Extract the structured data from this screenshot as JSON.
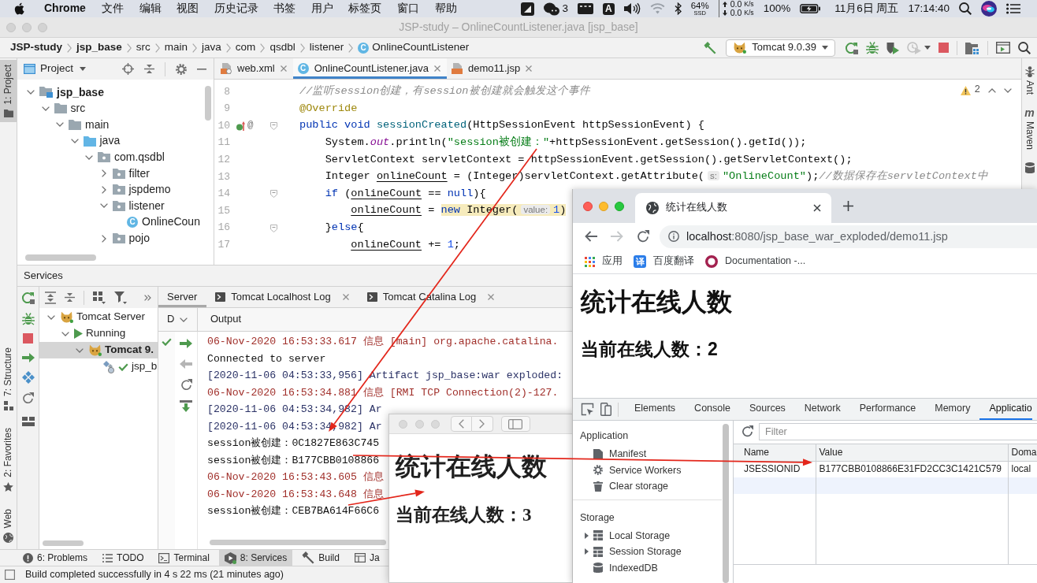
{
  "menu_bar": {
    "app": "Chrome",
    "menus": [
      "文件",
      "编辑",
      "视图",
      "历史记录",
      "书签",
      "用户",
      "标签页",
      "窗口",
      "帮助"
    ],
    "status": {
      "wechat_count": "3",
      "input_source": "A",
      "disk_usage": "64%",
      "disk_label": "SSD",
      "upload_rate": "0.0",
      "upload_unit": "K/s",
      "download_rate": "0.0",
      "download_unit": "K/s",
      "battery": "100%",
      "date": "11月6日 周五",
      "time": "17:14:40"
    }
  },
  "ide": {
    "title": "JSP-study – OnlineCountListener.java [jsp_base]",
    "breadcrumb": [
      {
        "label": "JSP-study",
        "kind": "project"
      },
      {
        "label": "jsp_base",
        "kind": "module"
      },
      {
        "label": "src",
        "kind": "folder"
      },
      {
        "label": "main",
        "kind": "folder"
      },
      {
        "label": "java",
        "kind": "folder"
      },
      {
        "label": "com",
        "kind": "folder"
      },
      {
        "label": "qsdbl",
        "kind": "folder"
      },
      {
        "label": "listener",
        "kind": "folder"
      },
      {
        "label": "OnlineCountListener",
        "kind": "class",
        "icon_letter": "C"
      }
    ],
    "run_config": "Tomcat 9.0.39",
    "left_strip": [
      {
        "label": "1: Project",
        "kind": "project",
        "selected": true
      },
      {
        "label": "7: Structure",
        "kind": "structure",
        "selected": false
      },
      {
        "label": "2: Favorites",
        "kind": "favorites",
        "selected": false
      },
      {
        "label": "Web",
        "kind": "web",
        "selected": false
      }
    ],
    "right_strip": [
      {
        "label": "Ant",
        "kind": "ant"
      },
      {
        "label": "Maven",
        "kind": "maven",
        "icon_letter": "m"
      },
      {
        "kind": "database"
      }
    ],
    "project": {
      "title": "Project",
      "tree": [
        {
          "label": "jsp_base",
          "kind": "module",
          "expanded": true,
          "children": [
            {
              "label": "src",
              "kind": "folder",
              "expanded": true,
              "children": [
                {
                  "label": "main",
                  "kind": "folder",
                  "expanded": true,
                  "children": [
                    {
                      "label": "java",
                      "kind": "source_root",
                      "expanded": true,
                      "children": [
                        {
                          "label": "com.qsdbl",
                          "kind": "package",
                          "expanded": true,
                          "children": [
                            {
                              "label": "filter",
                              "kind": "package",
                              "expanded": false
                            },
                            {
                              "label": "jspdemo",
                              "kind": "package",
                              "expanded": false
                            },
                            {
                              "label": "listener",
                              "kind": "package",
                              "expanded": true,
                              "children": [
                                {
                                  "label": "OnlineCoun",
                                  "kind": "class",
                                  "icon_letter": "C"
                                }
                              ]
                            },
                            {
                              "label": "pojo",
                              "kind": "package",
                              "expanded": false
                            }
                          ]
                        }
                      ]
                    }
                  ]
                }
              ]
            }
          ]
        }
      ]
    },
    "editor": {
      "tabs": [
        {
          "label": "web.xml",
          "kind": "xml",
          "selected": false
        },
        {
          "label": "OnlineCountListener.java",
          "kind": "class",
          "icon_letter": "C",
          "selected": true
        },
        {
          "label": "demo11.jsp",
          "kind": "jsp",
          "selected": false
        }
      ],
      "problem_count": "2",
      "lines": [
        {
          "number": "8",
          "fold": false,
          "overrides": false,
          "tokens": [
            {
              "kind": "comment",
              "text": "//监听session创建，有session被创建就会触发这个事件"
            }
          ]
        },
        {
          "number": "9",
          "fold": false,
          "overrides": false,
          "tokens": [
            {
              "kind": "annotation",
              "text": "@Override"
            }
          ]
        },
        {
          "number": "10",
          "fold": true,
          "overrides": true,
          "gutter_mark": "@",
          "tokens": [
            {
              "kind": "keyword",
              "text": "public void "
            },
            {
              "kind": "method",
              "text": "sessionCreated"
            },
            {
              "kind": "plain",
              "text": "(HttpSessionEvent httpSessionEvent) {"
            }
          ]
        },
        {
          "number": "11",
          "fold": false,
          "overrides": false,
          "tokens": [
            {
              "kind": "plain",
              "text": "    System."
            },
            {
              "kind": "static",
              "text": "out"
            },
            {
              "kind": "plain",
              "text": ".println("
            },
            {
              "kind": "string",
              "text": "\"session被创建：\""
            },
            {
              "kind": "plain",
              "text": "+httpSessionEvent.getSession().getId());"
            }
          ]
        },
        {
          "number": "12",
          "fold": false,
          "overrides": false,
          "tokens": [
            {
              "kind": "plain",
              "text": "    ServletContext servletContext = httpSessionEvent.getSession().getServletContext();"
            }
          ]
        },
        {
          "number": "13",
          "fold": false,
          "overrides": false,
          "tokens": [
            {
              "kind": "plain",
              "text": "    Integer "
            },
            {
              "kind": "variable",
              "text": "onlineCount"
            },
            {
              "kind": "plain",
              "text": " = (Integer)servletContext.getAttribute("
            },
            {
              "kind": "hint",
              "text": "s:"
            },
            {
              "kind": "string",
              "text": "\"OnlineCount\""
            },
            {
              "kind": "plain",
              "text": ");"
            },
            {
              "kind": "comment",
              "text": "//数据保存在servletContext中"
            }
          ]
        },
        {
          "number": "14",
          "fold": true,
          "overrides": false,
          "tokens": [
            {
              "kind": "keyword",
              "text": "    if"
            },
            {
              "kind": "plain",
              "text": " ("
            },
            {
              "kind": "variable",
              "text": "onlineCount"
            },
            {
              "kind": "plain",
              "text": " == "
            },
            {
              "kind": "keyword",
              "text": "null"
            },
            {
              "kind": "plain",
              "text": "){"
            }
          ]
        },
        {
          "number": "15",
          "fold": false,
          "overrides": false,
          "tokens": [
            {
              "kind": "variable",
              "text": "        onlineCount"
            },
            {
              "kind": "plain",
              "text": " = "
            },
            {
              "kind": "warning",
              "tokens": [
                {
                  "kind": "keyword",
                  "text": "new"
                },
                {
                  "kind": "plain",
                  "text": " Integer("
                },
                {
                  "kind": "hint",
                  "text": "value:"
                },
                {
                  "kind": "number",
                  "text": "1"
                },
                {
                  "kind": "plain",
                  "text": ")"
                }
              ]
            }
          ]
        },
        {
          "number": "16",
          "fold": true,
          "overrides": false,
          "tokens": [
            {
              "kind": "plain",
              "text": "    }"
            },
            {
              "kind": "keyword",
              "text": "else"
            },
            {
              "kind": "plain",
              "text": "{"
            }
          ]
        },
        {
          "number": "17",
          "fold": false,
          "overrides": false,
          "tokens": [
            {
              "kind": "variable",
              "text": "        onlineCount"
            },
            {
              "kind": "plain",
              "text": " += "
            },
            {
              "kind": "number",
              "text": "1"
            },
            {
              "kind": "plain",
              "text": ";"
            }
          ]
        }
      ]
    },
    "services": {
      "title": "Services",
      "tree": [
        {
          "label": "Tomcat Server",
          "kind": "server_group",
          "expanded": true,
          "selected": false,
          "children": [
            {
              "label": "Running",
              "kind": "running",
              "expanded": true,
              "selected": false,
              "children": [
                {
                  "label": "Tomcat 9.",
                  "kind": "server",
                  "expanded": true,
                  "selected": true,
                  "children": [
                    {
                      "label": "jsp_b",
                      "kind": "artifact",
                      "selected": false
                    }
                  ]
                }
              ]
            }
          ]
        }
      ],
      "tabs": [
        {
          "label": "Server",
          "kind": "server",
          "selected": true
        },
        {
          "label": "Tomcat Localhost Log",
          "kind": "log",
          "selected": false
        },
        {
          "label": "Tomcat Catalina Log",
          "kind": "log",
          "selected": false
        }
      ],
      "columns": [
        "D",
        "Output"
      ],
      "log": [
        {
          "kind": "info",
          "text": "06-Nov-2020 16:53:33.617 信息 [main] org.apache.catalina."
        },
        {
          "kind": "plain",
          "text": "Connected to server"
        },
        {
          "kind": "system",
          "text": "[2020-11-06 04:53:33,956] Artifact jsp_base:war exploded:"
        },
        {
          "kind": "info",
          "text": "06-Nov-2020 16:53:34.881 信息 [RMI TCP Connection(2)-127."
        },
        {
          "kind": "system",
          "text": "[2020-11-06 04:53:34,982] Ar"
        },
        {
          "kind": "system",
          "text": "[2020-11-06 04:53:34,982] Ar"
        },
        {
          "kind": "plain",
          "text": "session被创建：0C1827E863C745"
        },
        {
          "kind": "plain",
          "text": "session被创建：B177CBB0108866"
        },
        {
          "kind": "info",
          "text": "06-Nov-2020 16:53:43.605 信息"
        },
        {
          "kind": "info",
          "text": "06-Nov-2020 16:53:43.648 信息"
        },
        {
          "kind": "plain",
          "text": "session被创建：CEB7BA614F66C6"
        }
      ]
    },
    "tool_tabs": [
      {
        "label": "6: Problems",
        "kind": "problems",
        "selected": false
      },
      {
        "label": "TODO",
        "kind": "todo",
        "selected": false
      },
      {
        "label": "Terminal",
        "kind": "terminal",
        "selected": false
      },
      {
        "label": "8: Services",
        "kind": "services",
        "selected": true
      },
      {
        "label": "Build",
        "kind": "build",
        "selected": false
      },
      {
        "label": "Ja",
        "kind": "grid",
        "selected": false
      }
    ],
    "status_message": "Build completed successfully in 4 s 22 ms (21 minutes ago)"
  },
  "preview_window": {
    "heading": "统计在线人数",
    "count_line": "当前在线人数：3"
  },
  "browser": {
    "tabs": [
      {
        "title": "统计在线人数",
        "selected": true
      }
    ],
    "address": {
      "host": "localhost",
      "rest": ":8080/jsp_base_war_exploded/demo11.jsp"
    },
    "bookmarks": [
      {
        "label": "应用",
        "kind": "apps"
      },
      {
        "label": "百度翻译",
        "kind": "translate",
        "icon_char": "译"
      },
      {
        "label": "Documentation -...",
        "kind": "docs"
      }
    ],
    "page": {
      "heading": "统计在线人数",
      "count_line": "当前在线人数：2"
    },
    "devtools": {
      "tabs": [
        {
          "label": "Elements",
          "selected": false
        },
        {
          "label": "Console",
          "selected": false
        },
        {
          "label": "Sources",
          "selected": false
        },
        {
          "label": "Network",
          "selected": false
        },
        {
          "label": "Performance",
          "selected": false
        },
        {
          "label": "Memory",
          "selected": false
        },
        {
          "label": "Applicatio",
          "selected": true
        }
      ],
      "sidebar": [
        {
          "title": "Application",
          "items": [
            {
              "label": "Manifest",
              "kind": "file"
            },
            {
              "label": "Service Workers",
              "kind": "gear"
            },
            {
              "label": "Clear storage",
              "kind": "trash"
            }
          ]
        },
        {
          "title": "Storage",
          "items": [
            {
              "label": "Local Storage",
              "kind": "table",
              "expanded": false
            },
            {
              "label": "Session Storage",
              "kind": "table",
              "expanded": false
            },
            {
              "label": "IndexedDB",
              "kind": "database"
            }
          ]
        }
      ],
      "filter_placeholder": "Filter",
      "table": {
        "columns": [
          "Name",
          "Value",
          "Doma"
        ],
        "rows": [
          {
            "cells": [
              "JSESSIONID",
              "B177CBB0108866E31FD2CC3C1421C579",
              "local"
            ]
          }
        ]
      }
    }
  }
}
